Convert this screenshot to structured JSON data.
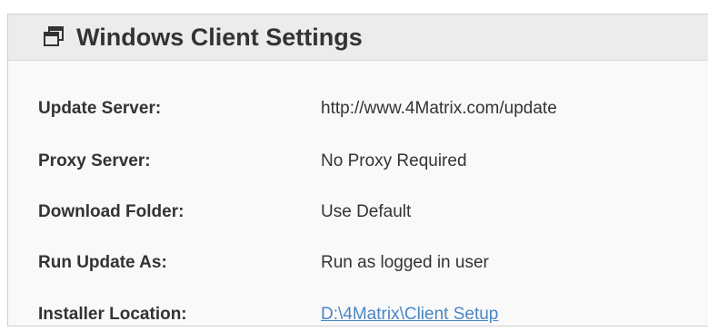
{
  "panel": {
    "title": "Windows Client Settings",
    "icon": "window-restore-icon"
  },
  "settings": [
    {
      "label": "Update Server:",
      "value": "http://www.4Matrix.com/update"
    },
    {
      "label": "Proxy Server:",
      "value": "No Proxy Required"
    },
    {
      "label": "Download Folder:",
      "value": "Use Default"
    },
    {
      "label": "Run Update As:",
      "value": "Run as logged in user"
    },
    {
      "label": "Installer Location:",
      "value": "D:\\4Matrix\\Client Setup"
    }
  ],
  "colors": {
    "text": "#333333",
    "link": "#4a86c8",
    "header_bg": "#ececec",
    "panel_bg": "#f9f9f9",
    "border": "#cfcfcf"
  }
}
